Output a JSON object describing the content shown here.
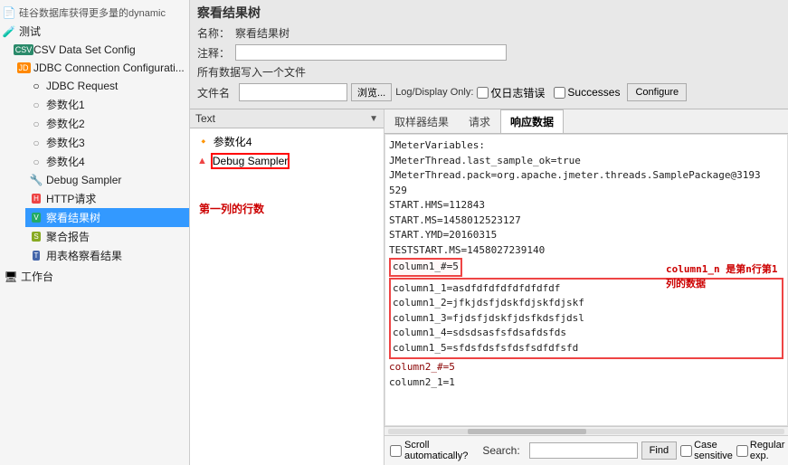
{
  "sidebar": {
    "title": "察看结果树",
    "items": [
      {
        "id": "dynamic",
        "label": "硅谷数据库获得更多量的dynamic",
        "level": 1,
        "type": "file",
        "indent": 0
      },
      {
        "id": "test",
        "label": "测试",
        "level": 1,
        "type": "test",
        "indent": 1
      },
      {
        "id": "csv",
        "label": "CSV Data Set Config",
        "level": 2,
        "type": "csv",
        "indent": 2
      },
      {
        "id": "jdbc",
        "label": "JDBC Connection Configurati...",
        "level": 2,
        "type": "jdbc",
        "indent": 2
      },
      {
        "id": "jdbc-req",
        "label": "JDBC Request",
        "level": 3,
        "type": "req",
        "indent": 3
      },
      {
        "id": "param1",
        "label": "参数化1",
        "level": 3,
        "type": "param",
        "indent": 3
      },
      {
        "id": "param2",
        "label": "参数化2",
        "level": 3,
        "type": "param",
        "indent": 3
      },
      {
        "id": "param3",
        "label": "参数化3",
        "level": 3,
        "type": "param",
        "indent": 3
      },
      {
        "id": "param4",
        "label": "参数化4",
        "level": 3,
        "type": "param",
        "indent": 3
      },
      {
        "id": "debug",
        "label": "Debug Sampler",
        "level": 3,
        "type": "debug",
        "indent": 3
      },
      {
        "id": "http",
        "label": "HTTP请求",
        "level": 3,
        "type": "http",
        "indent": 3
      },
      {
        "id": "view",
        "label": "察看结果树",
        "level": 3,
        "type": "view",
        "indent": 3,
        "selected": true
      },
      {
        "id": "summary",
        "label": "聚合报告",
        "level": 3,
        "type": "summary",
        "indent": 3
      },
      {
        "id": "table",
        "label": "用表格察看结果",
        "level": 3,
        "type": "table",
        "indent": 3
      },
      {
        "id": "workbench",
        "label": "工作台",
        "level": 1,
        "type": "workbench",
        "indent": 1
      }
    ]
  },
  "panel": {
    "title": "察看结果树",
    "name_label": "名称：",
    "name_value": "察看结果树",
    "comment_label": "注释：",
    "comment_value": "",
    "file_note": "所有数据写入一个文件",
    "file_label": "文件名",
    "file_value": "",
    "browse_label": "浏览...",
    "log_label": "Log/Display Only:",
    "checkbox_log": "仅日志错误",
    "checkbox_successes": "Successes",
    "configure_label": "Configure"
  },
  "left_panel": {
    "dropdown_label": "Text",
    "nodes": [
      {
        "id": "param4-node",
        "label": "参数化4",
        "type": "param"
      },
      {
        "id": "debug-node",
        "label": "Debug Sampler",
        "type": "debug",
        "highlight": true
      }
    ]
  },
  "tabs": [
    {
      "id": "sampler",
      "label": "取样器结果"
    },
    {
      "id": "request",
      "label": "请求"
    },
    {
      "id": "response",
      "label": "响应数据",
      "active": true
    }
  ],
  "response": {
    "lines": [
      "JMeterVariables:",
      "JMeterThread.last_sample_ok=true",
      "JMeterThread.pack=org.apache.jmeter.threads.SamplePackage@3193529",
      "START.HMS=112843",
      "START.MS=1458012523127",
      "START.YMD=20160315",
      "TESTSTART.MS=1458027239140",
      "column1_#=5",
      "column1_1=asdfdfdfdfdfdfdfdf",
      "column1_2=jfkjdsfjdskfdjskfdjskf",
      "column1_3=fjdsfjdskfjdsfkdsfjdsl",
      "column1_4=sdsdsasfsfdsafdsfds",
      "column1_5=sfdsfdsfsfdsfsdfdfsfd",
      "column2_#=5",
      "column2_1=1"
    ],
    "highlight_line": "column1_#=5",
    "highlight_group_start": 8,
    "highlight_group_end": 13
  },
  "annotations": {
    "first_col_rows": "第一列的行数",
    "col_n_desc": "column1_n 是第n行第1列的数据"
  },
  "bottom": {
    "scroll_label": "Scroll automatically?",
    "search_label": "Search:",
    "search_placeholder": "",
    "find_label": "Find",
    "case_label": "Case sensitive",
    "regex_label": "Regular exp."
  }
}
